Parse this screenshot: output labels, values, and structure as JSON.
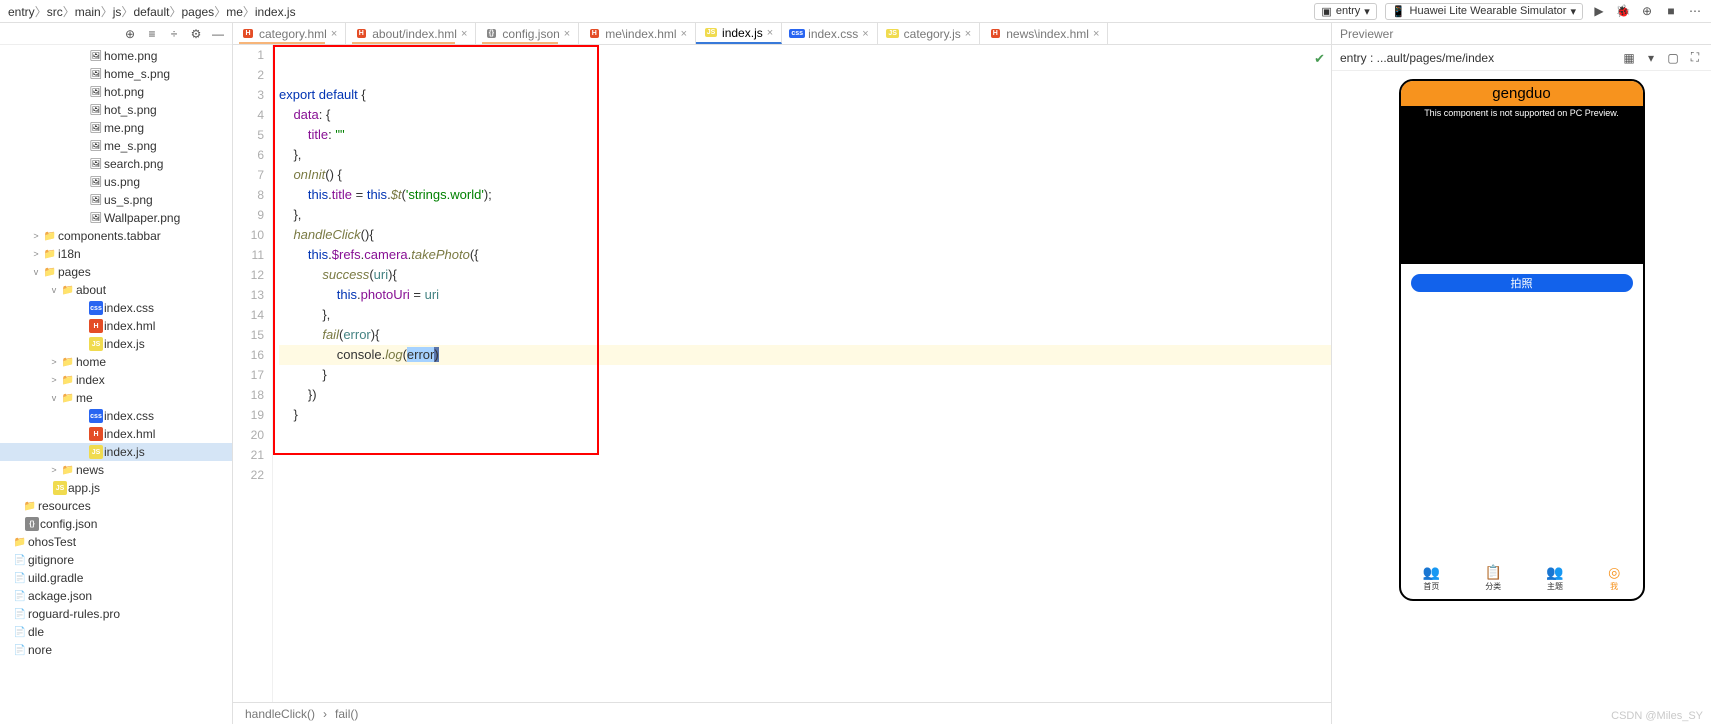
{
  "breadcrumb": [
    "entry",
    "src",
    "main",
    "js",
    "default",
    "pages",
    "me",
    "index.js"
  ],
  "toolbar_right": {
    "entry_dropdown": "entry",
    "emulator_dropdown": "Huawei Lite Wearable Simulator"
  },
  "file_tree": [
    {
      "indent": 76,
      "type": "png",
      "label": "home.png"
    },
    {
      "indent": 76,
      "type": "png",
      "label": "home_s.png"
    },
    {
      "indent": 76,
      "type": "png",
      "label": "hot.png"
    },
    {
      "indent": 76,
      "type": "png",
      "label": "hot_s.png"
    },
    {
      "indent": 76,
      "type": "png",
      "label": "me.png"
    },
    {
      "indent": 76,
      "type": "png",
      "label": "me_s.png"
    },
    {
      "indent": 76,
      "type": "png",
      "label": "search.png"
    },
    {
      "indent": 76,
      "type": "png",
      "label": "us.png"
    },
    {
      "indent": 76,
      "type": "png",
      "label": "us_s.png"
    },
    {
      "indent": 76,
      "type": "png",
      "label": "Wallpaper.png"
    },
    {
      "indent": 30,
      "arrow": ">",
      "type": "folder",
      "label": "components.tabbar"
    },
    {
      "indent": 30,
      "arrow": ">",
      "type": "folder",
      "label": "i18n"
    },
    {
      "indent": 30,
      "arrow": "v",
      "type": "folder",
      "label": "pages"
    },
    {
      "indent": 48,
      "arrow": "v",
      "type": "folder",
      "label": "about"
    },
    {
      "indent": 76,
      "type": "css",
      "label": "index.css"
    },
    {
      "indent": 76,
      "type": "hml",
      "label": "index.hml"
    },
    {
      "indent": 76,
      "type": "js",
      "label": "index.js"
    },
    {
      "indent": 48,
      "arrow": ">",
      "type": "folder",
      "label": "home"
    },
    {
      "indent": 48,
      "arrow": ">",
      "type": "folder",
      "label": "index"
    },
    {
      "indent": 48,
      "arrow": "v",
      "type": "folder",
      "label": "me"
    },
    {
      "indent": 76,
      "type": "css",
      "label": "index.css"
    },
    {
      "indent": 76,
      "type": "hml",
      "label": "index.hml"
    },
    {
      "indent": 76,
      "type": "js",
      "label": "index.js",
      "selected": true
    },
    {
      "indent": 48,
      "arrow": ">",
      "type": "folder",
      "label": "news"
    },
    {
      "indent": 40,
      "type": "js",
      "label": "app.js"
    },
    {
      "indent": 10,
      "type": "folder",
      "label": "resources"
    },
    {
      "indent": 12,
      "type": "json",
      "label": "config.json"
    },
    {
      "indent": 0,
      "type": "folder",
      "label": "ohosTest"
    },
    {
      "indent": 0,
      "type": "file",
      "label": "gitignore"
    },
    {
      "indent": 0,
      "type": "file",
      "label": "uild.gradle"
    },
    {
      "indent": 0,
      "type": "file",
      "label": "ackage.json"
    },
    {
      "indent": 0,
      "type": "file",
      "label": "roguard-rules.pro"
    },
    {
      "indent": 0,
      "type": "file",
      "label": "dle"
    },
    {
      "indent": 0,
      "type": "file",
      "label": "nore"
    }
  ],
  "tabs": [
    {
      "icon": "hml",
      "label": "category.hml",
      "underline": true
    },
    {
      "icon": "hml",
      "label": "about/index.hml",
      "underline": true
    },
    {
      "icon": "json",
      "label": "config.json",
      "underline": true
    },
    {
      "icon": "hml",
      "label": "me\\index.hml"
    },
    {
      "icon": "js",
      "label": "index.js",
      "active": true
    },
    {
      "icon": "css",
      "label": "index.css"
    },
    {
      "icon": "js",
      "label": "category.js"
    },
    {
      "icon": "hml",
      "label": "news\\index.hml"
    }
  ],
  "code_lines": [
    {
      "n": 1,
      "html": "<span class='kw'>export default</span> {"
    },
    {
      "n": 2,
      "html": "    <span class='prop'>data</span>: {"
    },
    {
      "n": 3,
      "html": "        <span class='prop'>title</span>: <span class='str'>\"\"</span>"
    },
    {
      "n": 4,
      "html": "    },"
    },
    {
      "n": 5,
      "html": "    <span class='fn'>onInit</span>() {"
    },
    {
      "n": 6,
      "html": "        <span class='this'>this</span>.<span class='prop'>title</span> = <span class='this'>this</span>.<span class='fn'>$t</span>(<span class='str'>'strings.world'</span>);"
    },
    {
      "n": 7,
      "html": "    },"
    },
    {
      "n": 8,
      "html": "    <span class='fn'>handleClick</span>(){"
    },
    {
      "n": 9,
      "html": "        <span class='this'>this</span>.<span class='prop'>$refs</span>.<span class='prop'>camera</span>.<span class='fn'>takePhoto</span>({"
    },
    {
      "n": 10,
      "html": "            <span class='fn'>success</span>(<span class='param'>uri</span>){"
    },
    {
      "n": 11,
      "html": "                <span class='this'>this</span>.<span class='prop'>photoUri</span> = <span class='param'>uri</span>"
    },
    {
      "n": 12,
      "html": "            },"
    },
    {
      "n": 13,
      "html": "            <span class='fn'>fail</span>(<span class='param'>error</span>){"
    },
    {
      "n": 14,
      "hl": true,
      "html": "                console.<span class='fn'>log</span>(<span class='sel'>error</span><span class='caret'>)</span>"
    },
    {
      "n": 15,
      "html": "            }"
    },
    {
      "n": 16,
      "html": "        })"
    },
    {
      "n": 17,
      "html": "    }"
    },
    {
      "n": 18,
      "html": ""
    },
    {
      "n": 19,
      "html": ""
    },
    {
      "n": 20,
      "html": ""
    },
    {
      "n": 21,
      "html": ""
    },
    {
      "n": 22,
      "html": ""
    }
  ],
  "status_breadcrumb": [
    "handleClick()",
    "fail()"
  ],
  "previewer": {
    "title": "Previewer",
    "path": "entry : ...ault/pages/me/index",
    "device": {
      "header": "gengduo",
      "msg": "This component is not supported on PC Preview.",
      "button": "拍照",
      "tabs": [
        {
          "icon": "👥",
          "label": "首页"
        },
        {
          "icon": "📋",
          "label": "分类"
        },
        {
          "icon": "👥",
          "label": "主题"
        },
        {
          "icon": "◎",
          "label": "我",
          "active": true
        }
      ]
    }
  },
  "watermark": "CSDN @Miles_SY"
}
